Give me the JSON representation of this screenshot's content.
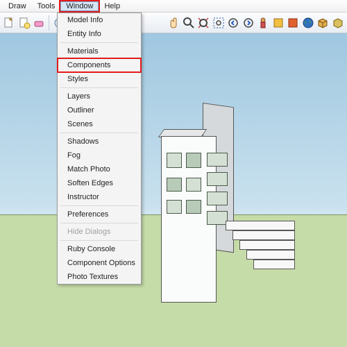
{
  "menubar": {
    "items": [
      {
        "label": "Draw",
        "active": false
      },
      {
        "label": "Tools",
        "active": false
      },
      {
        "label": "Window",
        "active": true
      },
      {
        "label": "Help",
        "active": false
      }
    ],
    "highlight_index": 2
  },
  "dropdown": {
    "highlight_index": 3,
    "groups": [
      [
        "Model Info",
        "Entity Info"
      ],
      [
        "Materials",
        "Components",
        "Styles"
      ],
      [
        "Layers",
        "Outliner",
        "Scenes"
      ],
      [
        "Shadows",
        "Fog",
        "Match Photo",
        "Soften Edges",
        "Instructor"
      ],
      [
        "Preferences"
      ],
      [
        "Hide Dialogs"
      ],
      [
        "Ruby Console",
        "Component Options",
        "Photo Textures"
      ]
    ],
    "disabled": [
      "Hide Dialogs"
    ]
  },
  "toolbar": {
    "icons": [
      "new-icon",
      "open-icon",
      "eraser-icon",
      "generic-icon",
      "generic-icon",
      "generic-icon",
      "generic-icon",
      "hand-icon",
      "zoom-icon",
      "arrow-icon",
      "zoom-extent-icon",
      "prev-icon",
      "next-icon",
      "person-icon",
      "color-icon",
      "color-icon",
      "globe-icon",
      "box-icon",
      "wrap-icon"
    ]
  },
  "scene": {
    "sky_color_top": "#9fc7e0",
    "sky_color_bottom": "#e6f0f5",
    "ground_color": "#c6dca8"
  }
}
